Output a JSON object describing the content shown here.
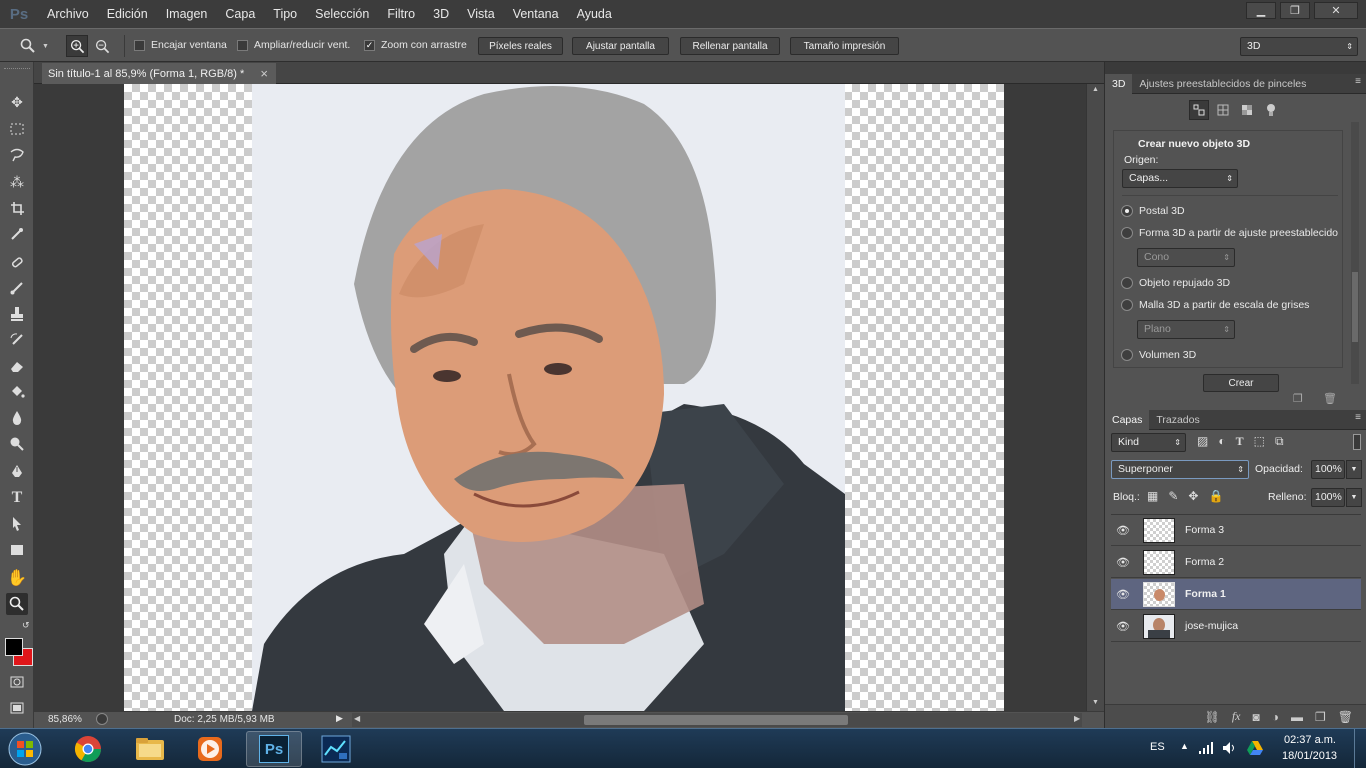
{
  "app": {
    "logo": "Ps"
  },
  "menu": [
    "Archivo",
    "Edición",
    "Imagen",
    "Capa",
    "Tipo",
    "Selección",
    "Filtro",
    "3D",
    "Vista",
    "Ventana",
    "Ayuda"
  ],
  "window_controls": {
    "minimize": "▁",
    "restore": "❐",
    "close": "✕"
  },
  "options_bar": {
    "fit_window_label": "Encajar ventana",
    "resize_label": "Ampliar/reducir vent.",
    "scrubby_label": "Zoom con arrastre",
    "scrubby_checked": true,
    "btn_actual_pixels": "Píxeles reales",
    "btn_fit_screen": "Ajustar pantalla",
    "btn_fill_screen": "Rellenar pantalla",
    "btn_print_size": "Tamaño impresión",
    "workspace": "3D"
  },
  "document": {
    "tab_title": "Sin título-1 al 85,9% (Forma 1, RGB/8) *",
    "close": "×"
  },
  "status": {
    "zoom": "85,86%",
    "doc_info": "Doc: 2,25 MB/5,93 MB"
  },
  "panel_3d": {
    "tabs": [
      "3D",
      "Ajustes preestablecidos de pinceles"
    ],
    "section_title": "Crear nuevo objeto 3D",
    "origin_label": "Origen:",
    "origin_value": "Capas...",
    "options": [
      {
        "label": "Postal 3D",
        "selected": true
      },
      {
        "label": "Forma 3D a partir de ajuste preestablecido",
        "selected": false
      },
      {
        "label": "Objeto repujado 3D",
        "selected": false
      },
      {
        "label": "Malla 3D a partir de escala de grises",
        "selected": false
      },
      {
        "label": "Volumen 3D",
        "selected": false
      }
    ],
    "shape_preset": "Cono",
    "mesh_preset": "Plano",
    "create_button": "Crear"
  },
  "layers_panel": {
    "tabs": [
      "Capas",
      "Trazados"
    ],
    "filter": "Kind",
    "blend_mode": "Superponer",
    "opacity_label": "Opacidad:",
    "opacity": "100%",
    "lock_label": "Bloq.:",
    "fill_label": "Relleno:",
    "fill": "100%",
    "layers": [
      {
        "name": "Forma 3",
        "selected": false,
        "visible": true
      },
      {
        "name": "Forma 2",
        "selected": false,
        "visible": true
      },
      {
        "name": "Forma 1",
        "selected": true,
        "visible": true
      },
      {
        "name": "jose-mujica",
        "selected": false,
        "visible": true
      }
    ]
  },
  "taskbar": {
    "language": "ES",
    "time": "02:37 a.m.",
    "date": "18/01/2013",
    "apps": [
      "windows-start",
      "chrome",
      "file-explorer",
      "media-player",
      "photoshop",
      "network-app"
    ]
  },
  "colors": {
    "accent_selected_layer": "#5e6580",
    "foreground": "#000000",
    "background": "#e0161a"
  }
}
